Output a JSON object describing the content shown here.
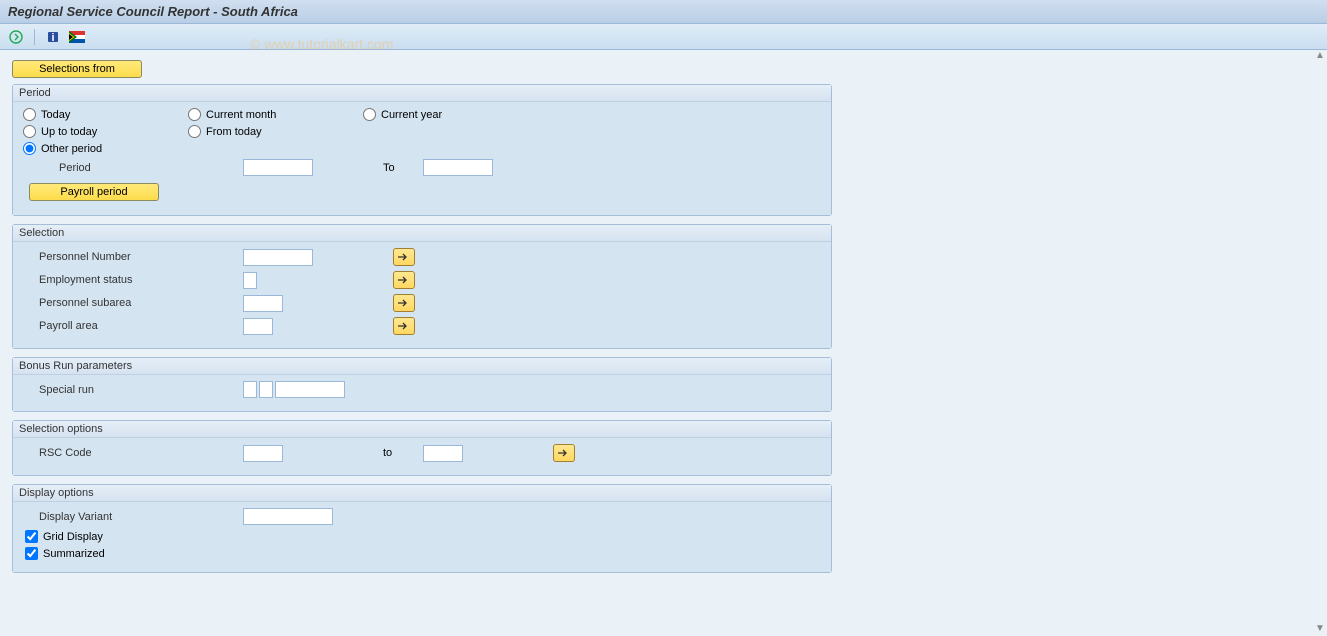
{
  "title": "Regional Service Council Report - South Africa",
  "watermark": "© www.tutorialkart.com",
  "toolbar": {
    "execute_name": "execute-icon",
    "info_name": "info-icon",
    "flag_name": "flag-icon"
  },
  "buttons": {
    "selections_from": "Selections from",
    "payroll_period": "Payroll period"
  },
  "groups": {
    "period": {
      "title": "Period",
      "radios": {
        "today": "Today",
        "current_month": "Current month",
        "current_year": "Current year",
        "up_to_today": "Up to today",
        "from_today": "From today",
        "other_period": "Other period"
      },
      "period_label": "Period",
      "to_label": "To",
      "selected": "other_period"
    },
    "selection": {
      "title": "Selection",
      "personnel_number": "Personnel Number",
      "employment_status": "Employment status",
      "personnel_subarea": "Personnel subarea",
      "payroll_area": "Payroll area"
    },
    "bonus": {
      "title": "Bonus Run parameters",
      "special_run": "Special run"
    },
    "sel_options": {
      "title": "Selection options",
      "rsc_code": "RSC Code",
      "to": "to"
    },
    "display": {
      "title": "Display options",
      "display_variant": "Display Variant",
      "grid_display": "Grid Display",
      "summarized": "Summarized",
      "grid_checked": true,
      "summarized_checked": true
    }
  }
}
